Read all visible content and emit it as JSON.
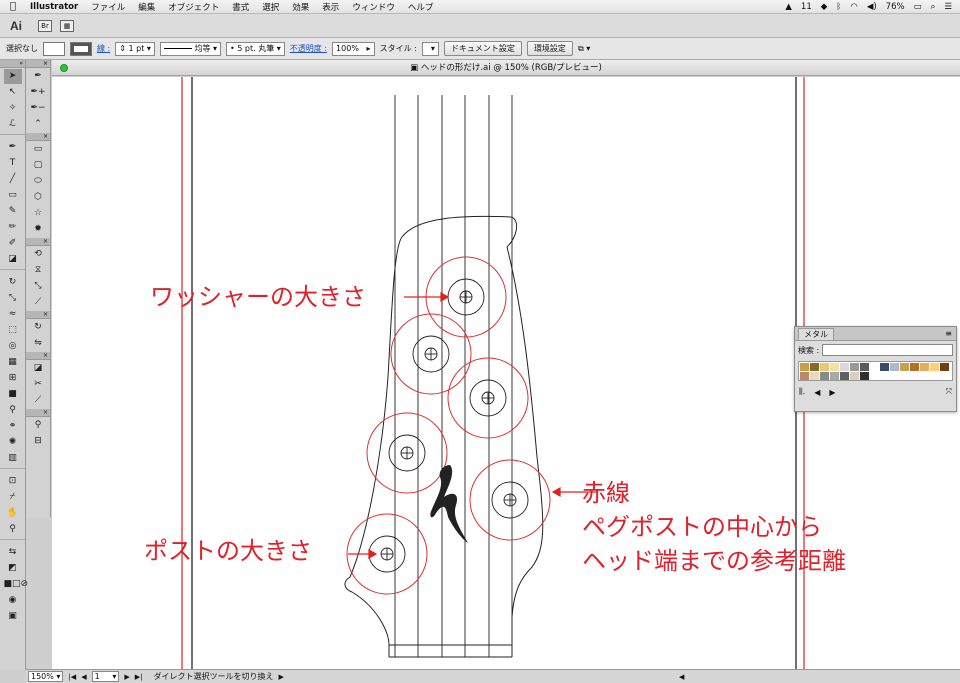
{
  "menubar": {
    "apple": "",
    "items": [
      "Illustrator",
      "ファイル",
      "編集",
      "オブジェクト",
      "書式",
      "選択",
      "効果",
      "表示",
      "ウィンドウ",
      "ヘルプ"
    ],
    "status_num": "11",
    "battery": "76%"
  },
  "appbar": {
    "logo": "Ai"
  },
  "control": {
    "selection": "選択なし",
    "stroke_label": "線 :",
    "stroke_weight": "1 pt",
    "profile": "均等",
    "brush": "5 pt. 丸筆",
    "opacity_label": "不透明度 :",
    "opacity": "100%",
    "style_label": "スタイル :",
    "doc_settings": "ドキュメント設定",
    "prefs": "環境設定"
  },
  "document": {
    "title": "ヘッドの形だけ.ai @ 150% (RGB/プレビュー)"
  },
  "annotations": {
    "washer": "ワッシャーの大きさ",
    "post": "ポストの大きさ",
    "red_line": "赤線",
    "line2": "ペグポストの中心から",
    "line3": "ヘッド端までの参考距離"
  },
  "panel": {
    "tab": "メタル",
    "search_label": "検索 :",
    "swatch_colors": [
      "#c9a04a",
      "#8a6a2a",
      "#e8c878",
      "#f1e0a0",
      "#d9d9d9",
      "#9a9a9a",
      "#5a5a5a",
      "#ffffff",
      "#3a4a6a",
      "#b0b8c8",
      "#c8a050",
      "#b07030",
      "#e0b060",
      "#f4d080",
      "#704010",
      "#c08860",
      "#e8d8c0",
      "#8a8a8a",
      "#a8a8a8",
      "#606060",
      "#d8d0c0",
      "#303030"
    ]
  },
  "status": {
    "zoom": "150%",
    "page": "1",
    "tool_hint": "ダイレクト選択ツールを切り換え"
  }
}
